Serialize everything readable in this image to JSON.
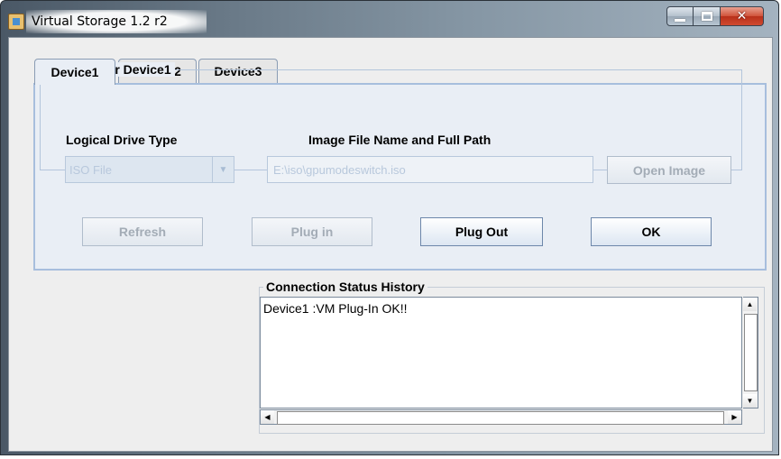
{
  "window": {
    "title": "Virtual Storage 1.2 r2",
    "buttons": {
      "minimize": "minimize",
      "maximize": "maximize",
      "close": "✕"
    }
  },
  "tabs": [
    {
      "label": "Device1",
      "active": true
    },
    {
      "label": "Device2",
      "active": false
    },
    {
      "label": "Device3",
      "active": false
    }
  ],
  "settings": {
    "group_title": "Settings for Device1",
    "drive_type_label": "Logical Drive Type",
    "drive_type_value": "ISO File",
    "image_path_label": "Image File Name and Full Path",
    "image_path_value": "E:\\iso\\gpumodeswitch.iso",
    "open_image_label": "Open Image"
  },
  "actions": {
    "refresh_label": "Refresh",
    "plug_in_label": "Plug in",
    "plug_out_label": "Plug Out",
    "ok_label": "OK"
  },
  "history": {
    "title": "Connection Status History",
    "lines": [
      "Device1 :VM Plug-In OK!!"
    ]
  },
  "colors": {
    "panel_border": "#a7bedd",
    "disabled_text": "#a3acb6",
    "close_button": "#c8402a"
  }
}
